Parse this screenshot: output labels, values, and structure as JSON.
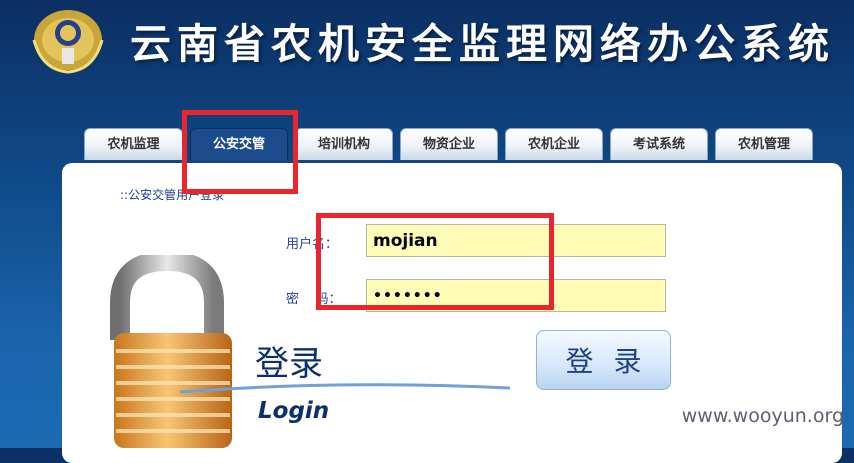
{
  "header": {
    "title": "云南省农机安全监理网络办公系统"
  },
  "tabs": [
    {
      "label": "农机监理"
    },
    {
      "label": "公安交管"
    },
    {
      "label": "培训机构"
    },
    {
      "label": "物资企业"
    },
    {
      "label": "农机企业"
    },
    {
      "label": "考试系统"
    },
    {
      "label": "农机管理"
    }
  ],
  "active_tab": "公安交管",
  "login": {
    "breadcrumb": "::公安交管用户登录",
    "username_label": "用户名：",
    "username_value": "mojian",
    "password_label": "密    码：",
    "password_value": "•••••••",
    "banner_cn": "登录",
    "banner_en": "Login",
    "submit_label": "登录"
  },
  "watermark": "www.wooyun.org",
  "colors": {
    "background": "#0f4a88",
    "active_tab": "#1c4c8c",
    "input_fill": "#fffcb8",
    "highlight": "#e8262e",
    "link": "#1a3a8a"
  },
  "icons": {
    "emblem": "police-emblem-icon",
    "lock": "padlock-icon"
  }
}
